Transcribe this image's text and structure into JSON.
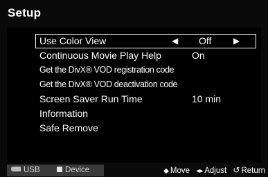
{
  "screen": {
    "title": "Setup"
  },
  "menu": {
    "items": [
      {
        "label": "Use Color View",
        "value": "Off",
        "selected": true,
        "arrow_left": "◀",
        "arrow_right": "▶"
      },
      {
        "label": "Continuous Movie Play Help",
        "value": "On"
      },
      {
        "label": "Get the DivX® VOD registration code",
        "value": ""
      },
      {
        "label": "Get the DivX® VOD deactivation code",
        "value": ""
      },
      {
        "label": "Screen Saver Run Time",
        "value": "10 min"
      },
      {
        "label": "Information",
        "value": ""
      },
      {
        "label": "Safe Remove",
        "value": ""
      }
    ]
  },
  "footer": {
    "usb_label": "USB",
    "device_label": "Device",
    "move_icon": "◆",
    "move_label": "Move",
    "adjust_icon": "◂▸",
    "adjust_label": "Adjust",
    "return_icon": "↺",
    "return_label": "Return"
  }
}
